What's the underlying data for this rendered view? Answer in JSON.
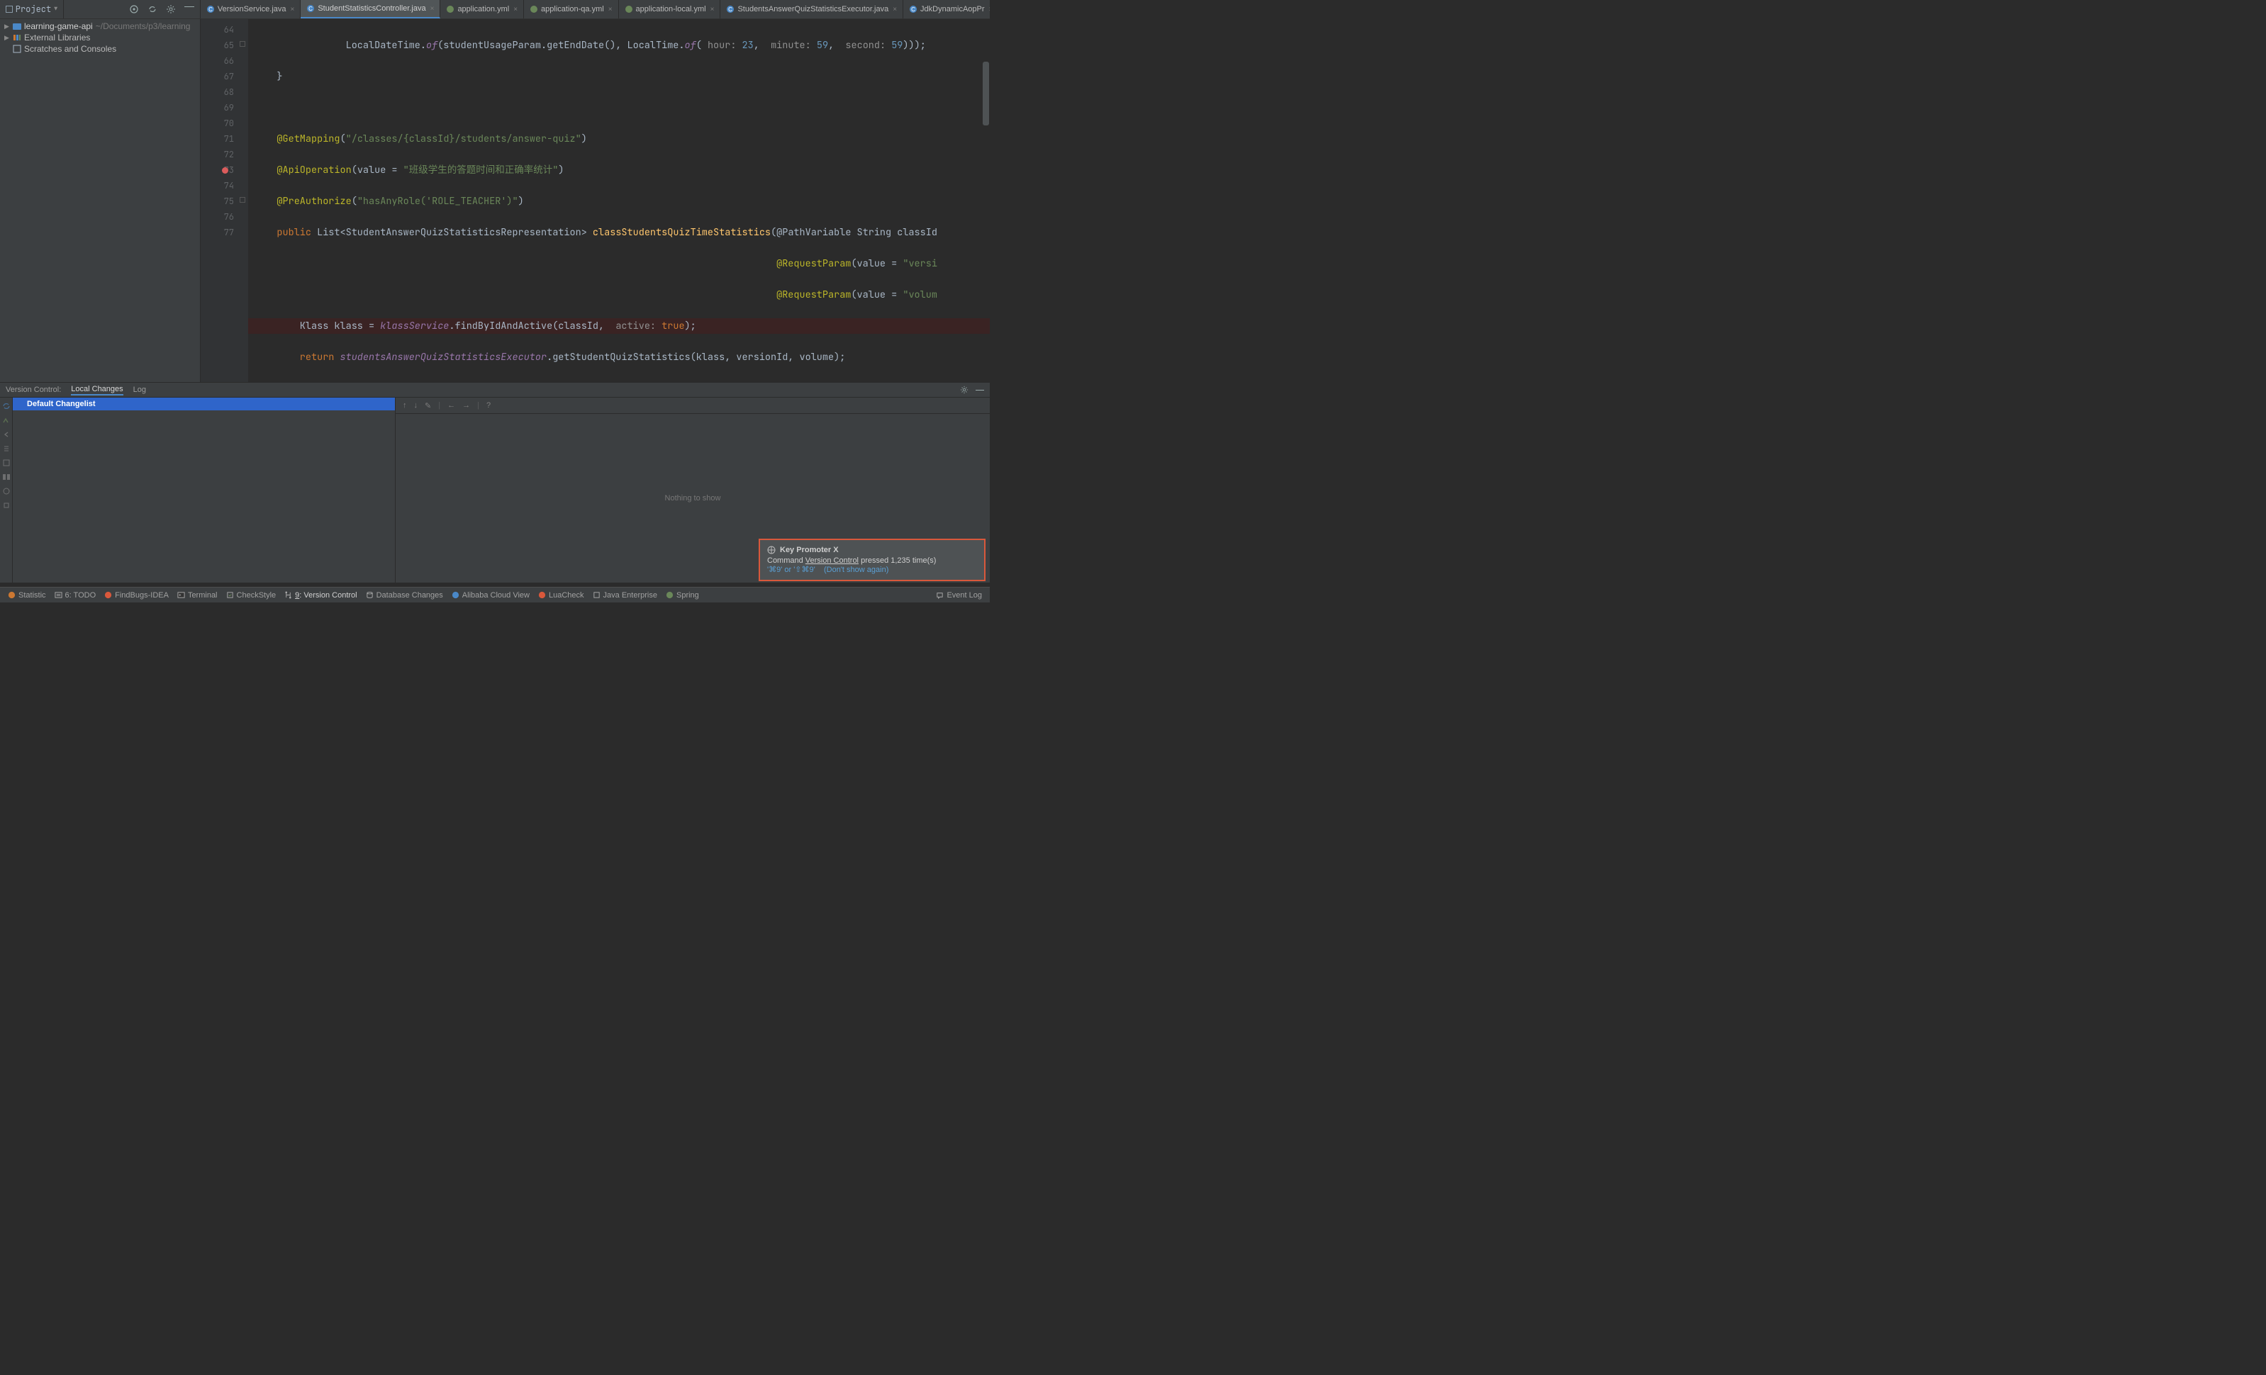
{
  "project_dropdown": {
    "label": "Project"
  },
  "tabs": [
    {
      "label": "VersionService.java",
      "icon": "class",
      "active": false
    },
    {
      "label": "StudentStatisticsController.java",
      "icon": "class",
      "active": true
    },
    {
      "label": "application.yml",
      "icon": "yml",
      "active": false
    },
    {
      "label": "application-qa.yml",
      "icon": "yml",
      "active": false
    },
    {
      "label": "application-local.yml",
      "icon": "yml",
      "active": false
    },
    {
      "label": "StudentsAnswerQuizStatisticsExecutor.java",
      "icon": "class",
      "active": false
    },
    {
      "label": "JdkDynamicAopPr",
      "icon": "class",
      "active": false
    }
  ],
  "tree": {
    "root": {
      "name": "learning-game-api",
      "hint": "~/Documents/p3/learning"
    },
    "lib": "External Libraries",
    "scratch": "Scratches and Consoles"
  },
  "gutter_start": 64,
  "gutter_end": 77,
  "breakpoint_line": 73,
  "code": {
    "l64": {
      "pre": "                LocalDateTime.",
      "of": "of",
      "mid1": "(studentUsageParam.getEndDate(), LocalTime.",
      "of2": "of",
      "open": "(",
      "p1l": "hour:",
      "p1v": "23",
      "s1": ",  ",
      "p2l": "minute:",
      "p2v": "59",
      "s2": ",  ",
      "p3l": "second:",
      "p3v": "59",
      "end": ")));"
    },
    "l65": "    }",
    "l67_ann": "@GetMapping",
    "l67_str": "\"/classes/{classId}/students/answer-quiz\"",
    "l68_ann": "@ApiOperation",
    "l68_kw": "value = ",
    "l68_str": "\"班级学生的答题时间和正确率统计\"",
    "l69_ann": "@PreAuthorize",
    "l69_str": "\"hasAnyRole('ROLE_TEACHER')\"",
    "l70_kw": "public ",
    "l70_type": "List<StudentAnswerQuizStatisticsRepresentation> ",
    "l70_m": "classStudentsQuizTimeStatistics",
    "l70_par": "(@PathVariable String classId",
    "l71_ann": "@RequestParam",
    "l71_kw": "value = ",
    "l71_str": "\"versi",
    "l72_ann": "@RequestParam",
    "l72_kw": "value = ",
    "l72_str": "\"volum",
    "l73_a": "        Klass klass = ",
    "l73_b": "klassService",
    "l73_c": ".findByIdAndActive(classId, ",
    "l73_p": "active:",
    "l73_v": "true",
    "l73_e": ");",
    "l74_kw": "        return ",
    "l74_b": "studentsAnswerQuizStatisticsExecutor",
    "l74_c": ".getStudentQuizStatistics(klass, versionId, volume);",
    "l75": "    }",
    "l76": "}"
  },
  "vcs": {
    "title": "Version Control:",
    "tabs": [
      "Local Changes",
      "Log"
    ],
    "active_tab": 0,
    "changelist": "Default Changelist",
    "empty": "Nothing to show",
    "help": "?"
  },
  "notif": {
    "title": "Key Promoter X",
    "l1a": "Command ",
    "l1u": "Version Control",
    "l1b": " pressed 1,235 time(s)",
    "l2a": "'⌘9' or '⇧⌘9'",
    "l2b": "(Don't show again)"
  },
  "status": [
    {
      "label": "Statistic",
      "icon": "statistic"
    },
    {
      "label": "6: TODO",
      "icon": "todo"
    },
    {
      "label": "FindBugs-IDEA",
      "icon": "findbugs"
    },
    {
      "label": "Terminal",
      "icon": "terminal"
    },
    {
      "label": "CheckStyle",
      "icon": "checkstyle"
    },
    {
      "label": "9: Version Control",
      "icon": "vcs",
      "active": true
    },
    {
      "label": "Database Changes",
      "icon": "db"
    },
    {
      "label": "Alibaba Cloud View",
      "icon": "ali"
    },
    {
      "label": "LuaCheck",
      "icon": "lua"
    },
    {
      "label": "Java Enterprise",
      "icon": "jee"
    },
    {
      "label": "Spring",
      "icon": "spring"
    }
  ],
  "eventlog": "Event Log"
}
